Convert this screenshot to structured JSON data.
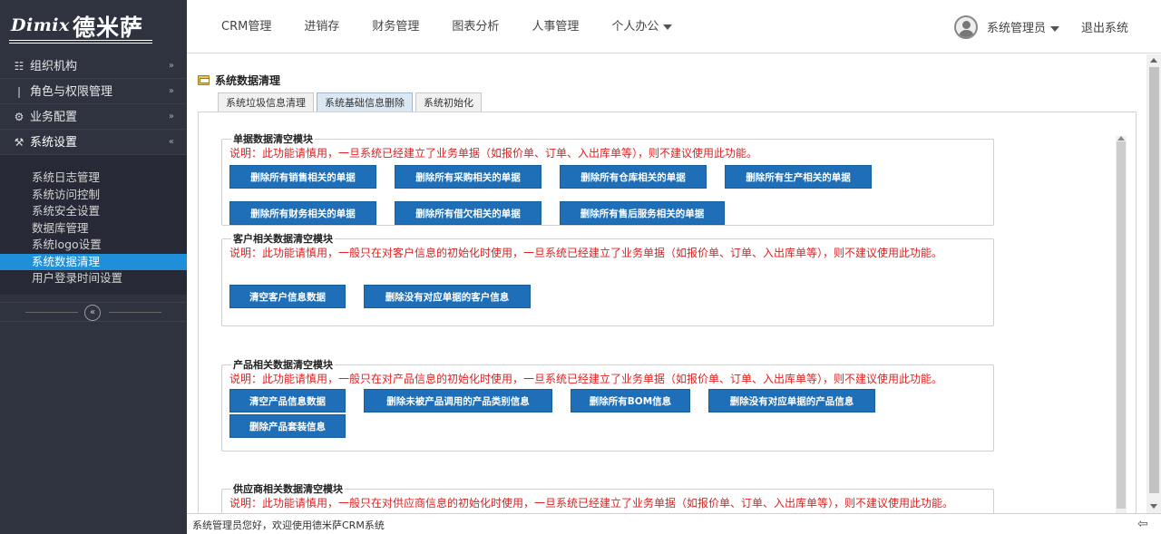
{
  "app": {
    "logo_latin": "Dimix",
    "logo_cn": "德米萨"
  },
  "topnav": {
    "items": [
      {
        "label": "CRM管理"
      },
      {
        "label": "进销存"
      },
      {
        "label": "财务管理"
      },
      {
        "label": "图表分析"
      },
      {
        "label": "人事管理"
      },
      {
        "label": "个人办公",
        "dropdown": true
      }
    ]
  },
  "user": {
    "name": "系统管理员",
    "logout": "退出系统"
  },
  "sidebar": {
    "groups": [
      {
        "label": "组织机构",
        "icon": "sitemap-icon",
        "chevron": "»"
      },
      {
        "label": "角色与权限管理",
        "icon": "pin-icon",
        "chevron": "»"
      },
      {
        "label": "业务配置",
        "icon": "gear-icon",
        "chevron": "»"
      },
      {
        "label": "系统设置",
        "icon": "wrench-icon",
        "chevron": "«"
      }
    ],
    "sub_items": [
      {
        "label": "系统日志管理"
      },
      {
        "label": "系统访问控制"
      },
      {
        "label": "系统安全设置"
      },
      {
        "label": "数据库管理"
      },
      {
        "label": "系统logo设置"
      },
      {
        "label": "系统数据清理",
        "active": true
      },
      {
        "label": "用户登录时间设置"
      }
    ],
    "collapse": "«"
  },
  "page": {
    "title": "系统数据清理",
    "tabs": [
      {
        "label": "系统垃圾信息清理"
      },
      {
        "label": "系统基础信息删除",
        "active": true
      },
      {
        "label": "系统初始化"
      }
    ]
  },
  "modules": [
    {
      "legend": "单据数据清空模块",
      "note": "说明：此功能请慎用，一旦系统已经建立了业务单据（如报价单、订单、入出库单等），则不建议使用此功能。",
      "rows": [
        [
          "删除所有销售相关的单据",
          "删除所有采购相关的单据",
          "删除所有仓库相关的单据",
          "删除所有生产相关的单据"
        ],
        [
          "删除所有财务相关的单据",
          "删除所有借欠相关的单据",
          "删除所有售后服务相关的单据"
        ]
      ]
    },
    {
      "legend": "客户相关数据清空模块",
      "note": "说明：此功能请慎用，一般只在对客户信息的初始化时使用，一旦系统已经建立了业务单据（如报价单、订单、入出库单等），则不建议使用此功能。",
      "rows": [
        [
          "清空客户信息数据",
          "删除没有对应单据的客户信息"
        ]
      ]
    },
    {
      "legend": "产品相关数据清空模块",
      "note": "说明：此功能请慎用，一般只在对产品信息的初始化时使用，一旦系统已经建立了业务单据（如报价单、订单、入出库单等），则不建议使用此功能。",
      "rows": [
        [
          "清空产品信息数据",
          "删除未被产品调用的产品类别信息",
          "删除所有BOM信息",
          "删除没有对应单据的产品信息"
        ],
        [
          "删除产品套装信息"
        ]
      ]
    },
    {
      "legend": "供应商相关数据清空模块",
      "note": "说明：此功能请慎用，一般只在对供应商信息的初始化时使用，一旦系统已经建立了业务单据（如报价单、订单、入出库单等），则不建议使用此功能。",
      "rows": []
    }
  ],
  "status": {
    "text": "系统管理员您好，欢迎使用德米萨CRM系统"
  },
  "colors": {
    "sidebar_bg": "#2f3340",
    "active_item": "#1e8fd8",
    "button_bg": "#1f6fb8",
    "warning_text": "#e02020"
  }
}
